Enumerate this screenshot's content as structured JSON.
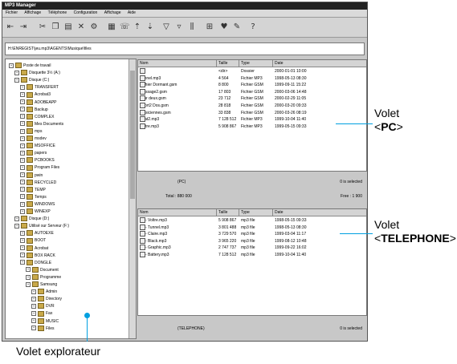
{
  "window": {
    "title": "MP3 Manager",
    "menu": [
      "Fichier",
      "Affichage",
      "Téléphone",
      "Configuration",
      "Affichage",
      "Aide"
    ],
    "path": "H:\\ENREGIST\\jeu.mp3\\AGENTS\\Musique\\files"
  },
  "explorer": {
    "nodes": [
      {
        "label": "Poste de travail",
        "indent": 0
      },
      {
        "label": "Disquette 3½ (A:)",
        "indent": 1
      },
      {
        "label": "Disque (C:)",
        "indent": 1
      },
      {
        "label": "TRANSFERT",
        "indent": 2
      },
      {
        "label": "Acrobat3",
        "indent": 2
      },
      {
        "label": "ADOBEAPP",
        "indent": 2
      },
      {
        "label": "Backup",
        "indent": 2
      },
      {
        "label": "COMPLEX",
        "indent": 2
      },
      {
        "label": "Mes Documents",
        "indent": 2
      },
      {
        "label": "mps",
        "indent": 2
      },
      {
        "label": "msdev",
        "indent": 2
      },
      {
        "label": "MSOFFICE",
        "indent": 2
      },
      {
        "label": "papers",
        "indent": 2
      },
      {
        "label": "PCBOOKS",
        "indent": 2
      },
      {
        "label": "Program Files",
        "indent": 2
      },
      {
        "label": "pwin",
        "indent": 2
      },
      {
        "label": "RECYCLED",
        "indent": 2
      },
      {
        "label": "TEMP",
        "indent": 2
      },
      {
        "label": "Temps",
        "indent": 2
      },
      {
        "label": "WINDOWS",
        "indent": 2
      },
      {
        "label": "WINEXP",
        "indent": 2
      },
      {
        "label": "Disque (D:)",
        "indent": 1
      },
      {
        "label": "Utilisé sur Serveur (F:)",
        "indent": 1
      },
      {
        "label": "AUTOEXE",
        "indent": 2
      },
      {
        "label": "BOOT",
        "indent": 2
      },
      {
        "label": "Acrobat",
        "indent": 2
      },
      {
        "label": "BOX RACK",
        "indent": 2
      },
      {
        "label": "DONGLE",
        "indent": 2
      },
      {
        "label": "Document",
        "indent": 3
      },
      {
        "label": "Programme",
        "indent": 3
      },
      {
        "label": "Samsung",
        "indent": 3
      },
      {
        "label": "Admin",
        "indent": 4
      },
      {
        "label": "Directory",
        "indent": 4
      },
      {
        "label": "DVR",
        "indent": 4
      },
      {
        "label": "Fax",
        "indent": 4
      },
      {
        "label": "MUSIC",
        "indent": 4
      },
      {
        "label": "Files",
        "indent": 4
      }
    ]
  },
  "pc_pane": {
    "columns": [
      "Nom",
      "Taille",
      "Type",
      "Date"
    ],
    "rows": [
      {
        "name": "..",
        "size": "<dir>",
        "type": "Dossier",
        "date": "2000-01-01 10:00"
      },
      {
        "name": "Tunnel.mp3",
        "size": "4 564",
        "type": "Fichier MP3",
        "date": "1998-05-13 08:30"
      },
      {
        "name": "Fichier Dormant.gsm",
        "size": "8 800",
        "type": "Fichier GSM",
        "date": "1999-09-11 15:22"
      },
      {
        "name": "Message2.gsm",
        "size": "17 803",
        "type": "Fichier GSM",
        "date": "2000-03-06 14:48"
      },
      {
        "name": "Jour deux.gsm",
        "size": "23 712",
        "type": "Fichier GSM",
        "date": "2000-02-29 11:05"
      },
      {
        "name": "Sport2 Dos.gsm",
        "size": "28 818",
        "type": "Fichier GSM",
        "date": "2000-03-20 09:33"
      },
      {
        "name": "Musiciennes.gsm",
        "size": "33 838",
        "type": "Fichier GSM",
        "date": "2000-03-26 08:19"
      },
      {
        "name": "Beat2.mp3",
        "size": "7 128 512",
        "type": "Fichier MP3",
        "date": "1999-10-04 11:40"
      },
      {
        "name": "Voltre.mp3",
        "size": "5 908 867",
        "type": "Fichier MP3",
        "date": "1999-05-15 09:33"
      }
    ],
    "info": {
      "drive": "(PC)",
      "total": "Total : 880 000",
      "selected": "0 is selected",
      "free": "Free : 1 900"
    }
  },
  "phone_pane": {
    "columns": [
      "Nom",
      "Taille",
      "Type",
      "Date"
    ],
    "rows": [
      {
        "name": "08 - Voltre.mp3",
        "size": "5 908 867",
        "type": "mp3 file",
        "date": "1998-05-15 09:33"
      },
      {
        "name": "02 - Tunnel.mp3",
        "size": "3 801 488",
        "type": "mp3 file",
        "date": "1998-05-13 08:30"
      },
      {
        "name": "03 - Claire.mp3",
        "size": "3 729 570",
        "type": "mp3 file",
        "date": "1999-03-04 11:17"
      },
      {
        "name": "04 - Black.mp3",
        "size": "3 965 220",
        "type": "mp3 file",
        "date": "1999-08-12 10:48"
      },
      {
        "name": "05 - Graphic.mp3",
        "size": "2 747 737",
        "type": "mp3 file",
        "date": "1999-09-22 16:02"
      },
      {
        "name": "06 - Battery.mp3",
        "size": "7 128 512",
        "type": "mp3 file",
        "date": "1999-10-04 11:40"
      }
    ],
    "info": {
      "drive": "(TELEPHONE)",
      "selected": "0 is selected"
    }
  },
  "annotations": {
    "pc": {
      "line1": "Volet",
      "open": "<",
      "bold": "PC",
      "close": ">"
    },
    "phone": {
      "line1": "Volet",
      "open": "<",
      "bold": "TELEPHONE",
      "close": ">"
    },
    "explorer": "Volet explorateur"
  },
  "colors": {
    "accent": "#00a0e0"
  }
}
